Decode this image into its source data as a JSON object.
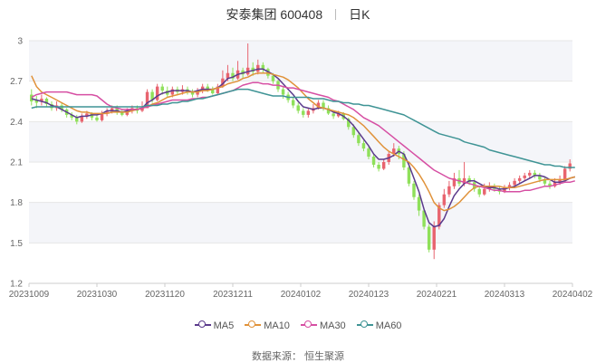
{
  "title": {
    "name": "安泰集团 600408",
    "period": "日K"
  },
  "source": "数据来源： 恒生聚源",
  "chart_data": {
    "type": "candlestick",
    "up_color": "#e8646f",
    "down_color": "#8fe05a",
    "ylim": [
      1.2,
      3.0
    ],
    "yticks": [
      "1.2",
      "1.5",
      "1.8",
      "2.1",
      "2.4",
      "2.7",
      "3"
    ],
    "xticks": [
      "20231009",
      "20231030",
      "20231120",
      "20231211",
      "20240102",
      "20240123",
      "20240221",
      "20240313",
      "20240402"
    ],
    "candles": [
      [
        2.6,
        2.55,
        2.64,
        2.52
      ],
      [
        2.56,
        2.54,
        2.59,
        2.5
      ],
      [
        2.55,
        2.57,
        2.6,
        2.52
      ],
      [
        2.57,
        2.53,
        2.58,
        2.51
      ],
      [
        2.53,
        2.5,
        2.55,
        2.48
      ],
      [
        2.5,
        2.52,
        2.55,
        2.48
      ],
      [
        2.52,
        2.49,
        2.54,
        2.47
      ],
      [
        2.49,
        2.45,
        2.5,
        2.43
      ],
      [
        2.45,
        2.43,
        2.47,
        2.41
      ],
      [
        2.43,
        2.4,
        2.45,
        2.38
      ],
      [
        2.4,
        2.44,
        2.46,
        2.39
      ],
      [
        2.44,
        2.46,
        2.48,
        2.42
      ],
      [
        2.46,
        2.43,
        2.47,
        2.41
      ],
      [
        2.43,
        2.41,
        2.45,
        2.4
      ],
      [
        2.41,
        2.46,
        2.48,
        2.4
      ],
      [
        2.46,
        2.48,
        2.5,
        2.44
      ],
      [
        2.48,
        2.5,
        2.52,
        2.46
      ],
      [
        2.5,
        2.47,
        2.52,
        2.45
      ],
      [
        2.47,
        2.45,
        2.49,
        2.44
      ],
      [
        2.45,
        2.48,
        2.5,
        2.44
      ],
      [
        2.48,
        2.5,
        2.52,
        2.46
      ],
      [
        2.5,
        2.48,
        2.52,
        2.46
      ],
      [
        2.48,
        2.5,
        2.55,
        2.47
      ],
      [
        2.5,
        2.62,
        2.64,
        2.5
      ],
      [
        2.62,
        2.56,
        2.64,
        2.54
      ],
      [
        2.56,
        2.66,
        2.68,
        2.55
      ],
      [
        2.66,
        2.63,
        2.68,
        2.6
      ],
      [
        2.63,
        2.6,
        2.66,
        2.58
      ],
      [
        2.6,
        2.64,
        2.66,
        2.58
      ],
      [
        2.64,
        2.62,
        2.66,
        2.6
      ],
      [
        2.62,
        2.64,
        2.67,
        2.6
      ],
      [
        2.64,
        2.62,
        2.66,
        2.6
      ],
      [
        2.62,
        2.6,
        2.64,
        2.58
      ],
      [
        2.6,
        2.63,
        2.65,
        2.58
      ],
      [
        2.63,
        2.66,
        2.68,
        2.61
      ],
      [
        2.66,
        2.64,
        2.68,
        2.62
      ],
      [
        2.64,
        2.61,
        2.66,
        2.6
      ],
      [
        2.61,
        2.66,
        2.68,
        2.6
      ],
      [
        2.66,
        2.72,
        2.78,
        2.65
      ],
      [
        2.72,
        2.76,
        2.82,
        2.7
      ],
      [
        2.76,
        2.72,
        2.8,
        2.7
      ],
      [
        2.72,
        2.78,
        2.85,
        2.71
      ],
      [
        2.78,
        2.75,
        2.8,
        2.72
      ],
      [
        2.75,
        2.8,
        2.98,
        2.74
      ],
      [
        2.8,
        2.77,
        2.84,
        2.74
      ],
      [
        2.77,
        2.82,
        2.86,
        2.75
      ],
      [
        2.82,
        2.79,
        2.84,
        2.76
      ],
      [
        2.79,
        2.74,
        2.8,
        2.72
      ],
      [
        2.74,
        2.7,
        2.76,
        2.68
      ],
      [
        2.7,
        2.64,
        2.71,
        2.62
      ],
      [
        2.64,
        2.6,
        2.66,
        2.57
      ],
      [
        2.6,
        2.56,
        2.62,
        2.54
      ],
      [
        2.56,
        2.52,
        2.58,
        2.5
      ],
      [
        2.52,
        2.48,
        2.54,
        2.46
      ],
      [
        2.48,
        2.45,
        2.5,
        2.43
      ],
      [
        2.45,
        2.48,
        2.5,
        2.43
      ],
      [
        2.48,
        2.5,
        2.53,
        2.46
      ],
      [
        2.5,
        2.54,
        2.56,
        2.49
      ],
      [
        2.54,
        2.5,
        2.56,
        2.48
      ],
      [
        2.5,
        2.46,
        2.52,
        2.45
      ],
      [
        2.46,
        2.44,
        2.48,
        2.42
      ],
      [
        2.44,
        2.46,
        2.48,
        2.43
      ],
      [
        2.46,
        2.42,
        2.47,
        2.41
      ],
      [
        2.42,
        2.36,
        2.43,
        2.34
      ],
      [
        2.36,
        2.3,
        2.38,
        2.28
      ],
      [
        2.3,
        2.24,
        2.32,
        2.22
      ],
      [
        2.24,
        2.2,
        2.26,
        2.18
      ],
      [
        2.2,
        2.14,
        2.22,
        2.12
      ],
      [
        2.14,
        2.08,
        2.16,
        2.06
      ],
      [
        2.08,
        2.05,
        2.1,
        2.03
      ],
      [
        2.05,
        2.1,
        2.12,
        2.04
      ],
      [
        2.1,
        2.16,
        2.18,
        2.08
      ],
      [
        2.16,
        2.2,
        2.24,
        2.14
      ],
      [
        2.2,
        2.16,
        2.22,
        2.12
      ],
      [
        2.16,
        2.06,
        2.18,
        2.04
      ],
      [
        2.06,
        1.94,
        2.08,
        1.92
      ],
      [
        1.94,
        1.84,
        1.96,
        1.82
      ],
      [
        1.84,
        1.74,
        1.86,
        1.7
      ],
      [
        1.74,
        1.62,
        1.76,
        1.6
      ],
      [
        1.62,
        1.45,
        1.64,
        1.43
      ],
      [
        1.45,
        1.62,
        1.66,
        1.38
      ],
      [
        1.62,
        1.78,
        1.8,
        1.6
      ],
      [
        1.78,
        1.86,
        1.9,
        1.76
      ],
      [
        1.86,
        1.92,
        1.96,
        1.84
      ],
      [
        1.92,
        1.98,
        2.02,
        1.9
      ],
      [
        1.98,
        1.94,
        2.04,
        1.92
      ],
      [
        1.94,
        1.98,
        2.1,
        1.92
      ],
      [
        1.98,
        1.95,
        2.0,
        1.93
      ],
      [
        1.95,
        1.9,
        1.98,
        1.88
      ],
      [
        1.9,
        1.86,
        1.92,
        1.84
      ],
      [
        1.86,
        1.9,
        1.94,
        1.85
      ],
      [
        1.9,
        1.92,
        1.95,
        1.88
      ],
      [
        1.92,
        1.9,
        1.94,
        1.88
      ],
      [
        1.9,
        1.88,
        1.92,
        1.86
      ],
      [
        1.88,
        1.91,
        1.93,
        1.87
      ],
      [
        1.91,
        1.93,
        1.95,
        1.89
      ],
      [
        1.93,
        1.96,
        1.98,
        1.91
      ],
      [
        1.96,
        1.98,
        2.0,
        1.94
      ],
      [
        1.98,
        2.0,
        2.02,
        1.96
      ],
      [
        2.0,
        2.02,
        2.04,
        1.98
      ],
      [
        2.02,
        2.0,
        2.04,
        1.98
      ],
      [
        2.0,
        1.97,
        2.02,
        1.95
      ],
      [
        1.97,
        1.94,
        1.99,
        1.92
      ],
      [
        1.94,
        1.92,
        1.96,
        1.9
      ],
      [
        1.92,
        1.95,
        1.98,
        1.91
      ],
      [
        1.95,
        1.97,
        2.0,
        1.93
      ],
      [
        1.97,
        2.05,
        2.07,
        1.96
      ],
      [
        2.05,
        2.09,
        2.12,
        2.03
      ]
    ],
    "series": [
      {
        "name": "MA5",
        "color": "#5b3a8c",
        "values": [
          2.57,
          2.56,
          2.55,
          2.54,
          2.52,
          2.51,
          2.49,
          2.47,
          2.45,
          2.43,
          2.44,
          2.44,
          2.45,
          2.45,
          2.46,
          2.48,
          2.48,
          2.48,
          2.47,
          2.48,
          2.49,
          2.49,
          2.5,
          2.54,
          2.56,
          2.59,
          2.61,
          2.62,
          2.63,
          2.63,
          2.63,
          2.63,
          2.62,
          2.63,
          2.64,
          2.64,
          2.64,
          2.65,
          2.68,
          2.72,
          2.73,
          2.75,
          2.76,
          2.77,
          2.78,
          2.79,
          2.79,
          2.77,
          2.75,
          2.72,
          2.68,
          2.64,
          2.6,
          2.55,
          2.51,
          2.5,
          2.49,
          2.5,
          2.5,
          2.49,
          2.47,
          2.46,
          2.44,
          2.41,
          2.37,
          2.32,
          2.27,
          2.22,
          2.16,
          2.12,
          2.12,
          2.13,
          2.15,
          2.18,
          2.16,
          2.08,
          1.98,
          1.88,
          1.75,
          1.65,
          1.62,
          1.63,
          1.68,
          1.77,
          1.85,
          1.9,
          1.94,
          1.96,
          1.96,
          1.94,
          1.92,
          1.91,
          1.91,
          1.9,
          1.9,
          1.91,
          1.92,
          1.94,
          1.96,
          1.98,
          2.0,
          2.0,
          1.99,
          1.97,
          1.95,
          1.95,
          1.96,
          1.98,
          1.99
        ]
      },
      {
        "name": "MA10",
        "color": "#e0923a",
        "values": [
          2.74,
          2.66,
          2.62,
          2.6,
          2.58,
          2.56,
          2.54,
          2.52,
          2.5,
          2.48,
          2.47,
          2.47,
          2.46,
          2.46,
          2.46,
          2.46,
          2.47,
          2.47,
          2.47,
          2.47,
          2.48,
          2.49,
          2.5,
          2.51,
          2.53,
          2.54,
          2.56,
          2.58,
          2.59,
          2.6,
          2.61,
          2.62,
          2.62,
          2.62,
          2.63,
          2.63,
          2.64,
          2.65,
          2.66,
          2.68,
          2.69,
          2.7,
          2.72,
          2.73,
          2.75,
          2.76,
          2.76,
          2.76,
          2.75,
          2.74,
          2.73,
          2.71,
          2.68,
          2.65,
          2.61,
          2.57,
          2.54,
          2.51,
          2.5,
          2.49,
          2.48,
          2.47,
          2.46,
          2.45,
          2.43,
          2.4,
          2.37,
          2.33,
          2.29,
          2.25,
          2.21,
          2.18,
          2.16,
          2.14,
          2.12,
          2.1,
          2.06,
          2.01,
          1.95,
          1.88,
          1.8,
          1.76,
          1.74,
          1.75,
          1.77,
          1.8,
          1.84,
          1.88,
          1.91,
          1.92,
          1.92,
          1.92,
          1.92,
          1.92,
          1.91,
          1.91,
          1.91,
          1.92,
          1.93,
          1.94,
          1.95,
          1.96,
          1.97,
          1.97,
          1.97,
          1.97,
          1.97,
          1.98,
          1.99
        ]
      },
      {
        "name": "MA30",
        "color": "#d64fa3",
        "values": [
          2.58,
          2.6,
          2.61,
          2.62,
          2.62,
          2.62,
          2.62,
          2.62,
          2.61,
          2.6,
          2.6,
          2.6,
          2.6,
          2.59,
          2.56,
          2.53,
          2.51,
          2.5,
          2.49,
          2.49,
          2.49,
          2.49,
          2.5,
          2.51,
          2.52,
          2.53,
          2.54,
          2.55,
          2.56,
          2.56,
          2.56,
          2.56,
          2.57,
          2.57,
          2.58,
          2.58,
          2.59,
          2.6,
          2.61,
          2.62,
          2.63,
          2.65,
          2.67,
          2.68,
          2.69,
          2.69,
          2.68,
          2.68,
          2.67,
          2.67,
          2.66,
          2.65,
          2.65,
          2.64,
          2.63,
          2.62,
          2.61,
          2.6,
          2.59,
          2.58,
          2.56,
          2.55,
          2.53,
          2.51,
          2.49,
          2.46,
          2.43,
          2.41,
          2.39,
          2.37,
          2.34,
          2.31,
          2.28,
          2.25,
          2.22,
          2.19,
          2.16,
          2.13,
          2.1,
          2.07,
          2.04,
          2.02,
          2.0,
          1.98,
          1.97,
          1.96,
          1.95,
          1.94,
          1.93,
          1.92,
          1.91,
          1.9,
          1.89,
          1.89,
          1.88,
          1.88,
          1.88,
          1.88,
          1.89,
          1.89,
          1.9,
          1.91,
          1.92,
          1.92,
          1.93,
          1.94,
          1.95,
          1.95,
          1.96
        ]
      },
      {
        "name": "MA60",
        "color": "#3f9495",
        "values": [
          2.5,
          2.51,
          2.51,
          2.51,
          2.51,
          2.51,
          2.51,
          2.51,
          2.51,
          2.51,
          2.51,
          2.51,
          2.51,
          2.51,
          2.51,
          2.51,
          2.51,
          2.51,
          2.51,
          2.51,
          2.51,
          2.51,
          2.51,
          2.52,
          2.52,
          2.52,
          2.53,
          2.53,
          2.54,
          2.54,
          2.55,
          2.55,
          2.56,
          2.57,
          2.57,
          2.58,
          2.59,
          2.6,
          2.61,
          2.62,
          2.63,
          2.64,
          2.64,
          2.64,
          2.63,
          2.62,
          2.61,
          2.6,
          2.59,
          2.59,
          2.59,
          2.58,
          2.58,
          2.58,
          2.58,
          2.58,
          2.57,
          2.57,
          2.57,
          2.56,
          2.55,
          2.55,
          2.54,
          2.54,
          2.53,
          2.53,
          2.52,
          2.52,
          2.51,
          2.5,
          2.49,
          2.48,
          2.47,
          2.46,
          2.45,
          2.43,
          2.41,
          2.39,
          2.37,
          2.35,
          2.33,
          2.31,
          2.3,
          2.29,
          2.28,
          2.27,
          2.25,
          2.24,
          2.23,
          2.22,
          2.21,
          2.19,
          2.18,
          2.17,
          2.16,
          2.15,
          2.14,
          2.13,
          2.12,
          2.11,
          2.1,
          2.09,
          2.08,
          2.08,
          2.07,
          2.07,
          2.06,
          2.06,
          2.06
        ]
      }
    ]
  }
}
